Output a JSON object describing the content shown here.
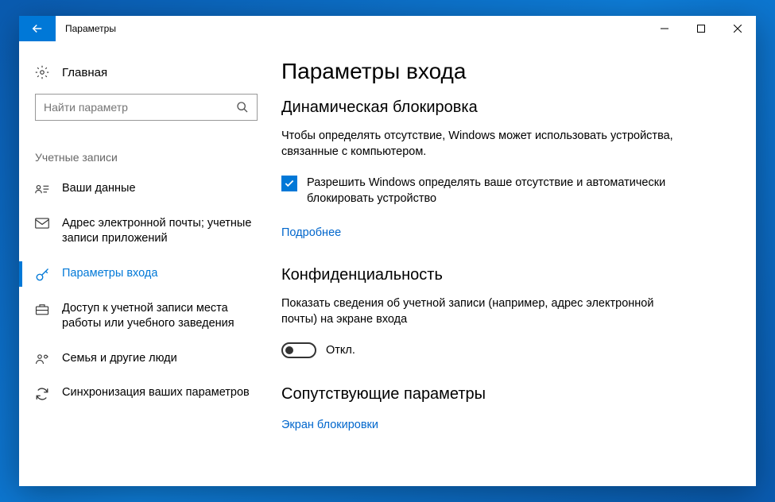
{
  "window": {
    "title": "Параметры"
  },
  "sidebar": {
    "home_label": "Главная",
    "search_placeholder": "Найти параметр",
    "section_label": "Учетные записи",
    "items": [
      {
        "label": "Ваши данные"
      },
      {
        "label": "Адрес электронной почты; учетные записи приложений"
      },
      {
        "label": "Параметры входа"
      },
      {
        "label": "Доступ к учетной записи места работы или учебного заведения"
      },
      {
        "label": "Семья и другие люди"
      },
      {
        "label": "Синхронизация ваших параметров"
      }
    ]
  },
  "content": {
    "page_title": "Параметры входа",
    "dynamic_lock": {
      "title": "Динамическая блокировка",
      "desc": "Чтобы определять отсутствие, Windows может использовать устройства, связанные с компьютером.",
      "checkbox_label": "Разрешить Windows определять ваше отсутствие и автоматически блокировать устройство",
      "more_link": "Подробнее"
    },
    "privacy": {
      "title": "Конфиденциальность",
      "desc": "Показать сведения об учетной записи (например, адрес электронной почты) на экране входа",
      "toggle_label": "Откл."
    },
    "related": {
      "title": "Сопутствующие параметры",
      "link": "Экран блокировки"
    }
  }
}
